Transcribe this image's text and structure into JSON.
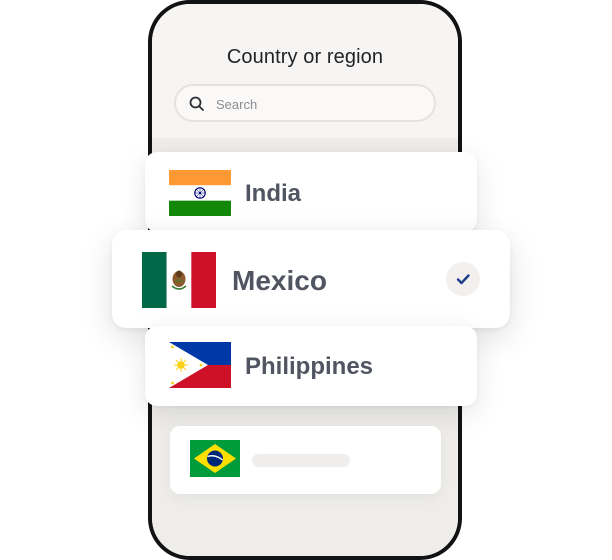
{
  "screen": {
    "title": "Country or region",
    "search": {
      "placeholder": "Search",
      "value": ""
    }
  },
  "countries": [
    {
      "name": "India",
      "flag_icon": "india-flag-icon",
      "selected": false
    },
    {
      "name": "Mexico",
      "flag_icon": "mexico-flag-icon",
      "selected": true
    },
    {
      "name": "Philippines",
      "flag_icon": "philippines-flag-icon",
      "selected": false
    },
    {
      "name": "",
      "flag_icon": "brazil-flag-icon",
      "selected": false
    }
  ],
  "icons": {
    "search": "search-icon",
    "selected": "checkmark-icon"
  },
  "colors": {
    "accent": "#1f3c88",
    "text_primary": "#1f2126",
    "country_text": "#505561",
    "screen_background": "#f6f5f3",
    "phone_frame": "#111214"
  }
}
